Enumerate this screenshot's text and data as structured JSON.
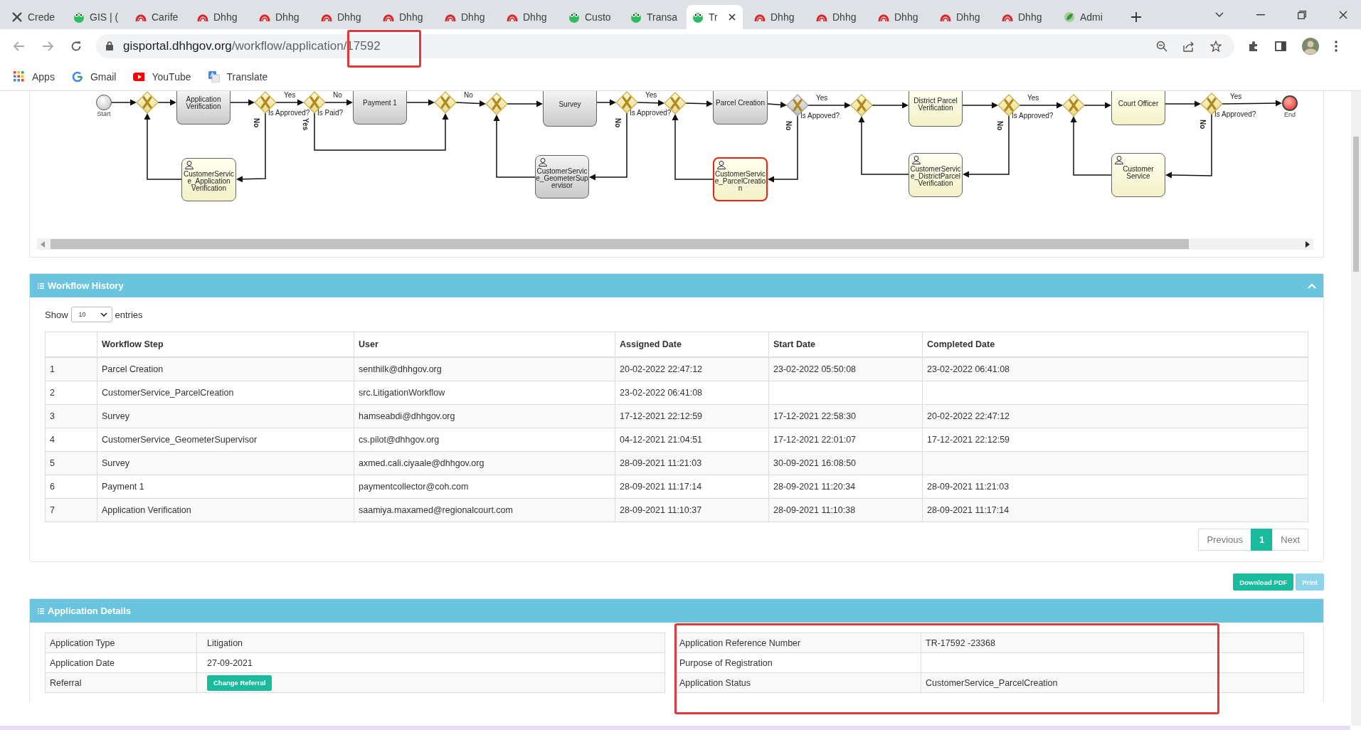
{
  "browser": {
    "tabs": [
      {
        "title": "Crede",
        "kind": "x",
        "selected": false
      },
      {
        "title": "GIS | (",
        "kind": "frog",
        "selected": false
      },
      {
        "title": "Carife",
        "kind": "arch",
        "selected": false
      },
      {
        "title": "Dhhg",
        "kind": "arch",
        "selected": false
      },
      {
        "title": "Dhhg",
        "kind": "arch",
        "selected": false
      },
      {
        "title": "Dhhg",
        "kind": "arch",
        "selected": false
      },
      {
        "title": "Dhhg",
        "kind": "arch",
        "selected": false
      },
      {
        "title": "Dhhg",
        "kind": "arch",
        "selected": false
      },
      {
        "title": "Dhhg",
        "kind": "arch",
        "selected": false
      },
      {
        "title": "Custo",
        "kind": "frog",
        "selected": false
      },
      {
        "title": "Transa",
        "kind": "frog",
        "selected": false
      },
      {
        "title": "Tr",
        "kind": "frog",
        "selected": true
      },
      {
        "title": "Dhhg",
        "kind": "arch",
        "selected": false
      },
      {
        "title": "Dhhg",
        "kind": "arch",
        "selected": false
      },
      {
        "title": "Dhhg",
        "kind": "arch",
        "selected": false
      },
      {
        "title": "Dhhg",
        "kind": "arch",
        "selected": false
      },
      {
        "title": "Dhhg",
        "kind": "arch",
        "selected": false
      },
      {
        "title": "Admi",
        "kind": "leaf",
        "selected": false
      }
    ],
    "url_host": "gisportal.dhhgov.org",
    "url_path": "/workflow/application/17592",
    "bookmarks": [
      {
        "label": "Apps",
        "kind": "apps"
      },
      {
        "label": "Gmail",
        "kind": "gmail"
      },
      {
        "label": "YouTube",
        "kind": "youtube"
      },
      {
        "label": "Translate",
        "kind": "translate"
      }
    ]
  },
  "workflow_diagram": {
    "nodes": [
      {
        "kind": "start",
        "label": "Start"
      },
      {
        "kind": "gateway",
        "completed": false
      },
      {
        "kind": "task",
        "label": "Application Verification",
        "completed": true,
        "current": false
      },
      {
        "kind": "gateway",
        "completed": false,
        "question": "Is Approved?",
        "forward_label": "Yes",
        "down_label": "No"
      },
      {
        "kind": "gateway",
        "completed": false,
        "question": "Is Paid?",
        "forward_label": "No",
        "down_label": "Yes"
      },
      {
        "kind": "task",
        "label": "Payment 1",
        "completed": true,
        "current": false
      },
      {
        "kind": "gateway",
        "completed": false,
        "forward_label": "No"
      },
      {
        "kind": "gateway",
        "completed": false
      },
      {
        "kind": "task",
        "label": "Survey",
        "completed": true,
        "current": false
      },
      {
        "kind": "gateway",
        "completed": false,
        "question": "Is Approved?",
        "forward_label": "Yes",
        "down_label": "No"
      },
      {
        "kind": "gateway",
        "completed": false
      },
      {
        "kind": "task",
        "label": "Parcel Creation",
        "completed": true,
        "current": false
      },
      {
        "kind": "gateway",
        "completed": true,
        "question": "Is Appoved?",
        "forward_label": "Yes",
        "down_label": "No"
      },
      {
        "kind": "gateway",
        "completed": false
      },
      {
        "kind": "task",
        "label": "District Parcel Verification",
        "completed": false,
        "current": false
      },
      {
        "kind": "gateway",
        "completed": false,
        "question": "Is Approved?",
        "forward_label": "Yes",
        "down_label": "No"
      },
      {
        "kind": "gateway",
        "completed": false
      },
      {
        "kind": "task",
        "label": "Court Officer",
        "completed": false,
        "current": false
      },
      {
        "kind": "gateway",
        "completed": false,
        "question": "Is Approved?",
        "forward_label": "Yes",
        "down_label": "No"
      },
      {
        "kind": "end",
        "label": "End"
      },
      {
        "kind": "user_task",
        "label": "CustomerService_Application Verification",
        "completed": false,
        "current": false
      },
      {
        "kind": "user_task",
        "label": "CustomerService_GeometerSupervisor",
        "completed": true,
        "current": false
      },
      {
        "kind": "user_task",
        "label": "CustomerService_ParcelCreation",
        "completed": false,
        "current": true
      },
      {
        "kind": "user_task",
        "label": "CustomerService_DistrictParcelVerification",
        "completed": false,
        "current": false
      },
      {
        "kind": "user_task",
        "label": "Customer Service",
        "completed": false,
        "current": false
      }
    ]
  },
  "workflow_history": {
    "title": "Workflow History",
    "show_label": "Show",
    "page_size": "10",
    "entries_label": "entries",
    "columns": [
      "Workflow Step",
      "User",
      "Assigned Date",
      "Start Date",
      "Completed Date"
    ],
    "rows": [
      {
        "number": "1",
        "cells": [
          "Parcel Creation",
          "senthilk@dhhgov.org",
          "20-02-2022 22:47:12",
          "23-02-2022 05:50:08",
          "23-02-2022 06:41:08"
        ]
      },
      {
        "number": "2",
        "cells": [
          "CustomerService_ParcelCreation",
          "src.LitigationWorkflow",
          "23-02-2022 06:41:08",
          null,
          null
        ]
      },
      {
        "number": "3",
        "cells": [
          "Survey",
          "hamseabdi@dhhgov.org",
          "17-12-2021 22:12:59",
          "17-12-2021 22:58:30",
          "20-02-2022 22:47:12"
        ]
      },
      {
        "number": "4",
        "cells": [
          "CustomerService_GeometerSupervisor",
          "cs.pilot@dhhgov.org",
          "04-12-2021 21:04:51",
          "17-12-2021 22:01:07",
          "17-12-2021 22:12:59"
        ]
      },
      {
        "number": "5",
        "cells": [
          "Survey",
          "axmed.cali.ciyaale@dhhgov.org",
          "28-09-2021 11:21:03",
          "30-09-2021 16:08:50",
          null
        ]
      },
      {
        "number": "6",
        "cells": [
          "Payment 1",
          "paymentcollector@coh.com",
          "28-09-2021 11:17:14",
          "28-09-2021 11:20:34",
          "28-09-2021 11:21:03"
        ]
      },
      {
        "number": "7",
        "cells": [
          "Application Verification",
          "saamiya.maxamed@regionalcourt.com",
          "28-09-2021 11:10:37",
          "28-09-2021 11:10:38",
          "28-09-2021 11:17:14"
        ]
      }
    ],
    "pagination": [
      {
        "label": "Previous",
        "selected": false
      },
      {
        "label": "1",
        "selected": true
      },
      {
        "label": "Next",
        "selected": false
      }
    ]
  },
  "actions": [
    {
      "label": "Download PDF",
      "kind": "primary"
    },
    {
      "label": "Print",
      "kind": "info"
    }
  ],
  "application_details": {
    "title": "Application Details",
    "left": [
      {
        "label": "Application Type",
        "value": "Litigation"
      },
      {
        "label": "Application Date",
        "value": "27-09-2021"
      },
      {
        "label": "Referral",
        "button": "Change Referral"
      }
    ],
    "right": [
      {
        "label": "Application Reference Number",
        "value": "TR-17592 -23368"
      },
      {
        "label": "Purpose of Registration"
      },
      {
        "label": "Application Status",
        "value": "CustomerService_ParcelCreation"
      }
    ]
  },
  "annotations": [
    {
      "kind": "highlight-box"
    },
    {
      "kind": "highlight-box"
    }
  ]
}
